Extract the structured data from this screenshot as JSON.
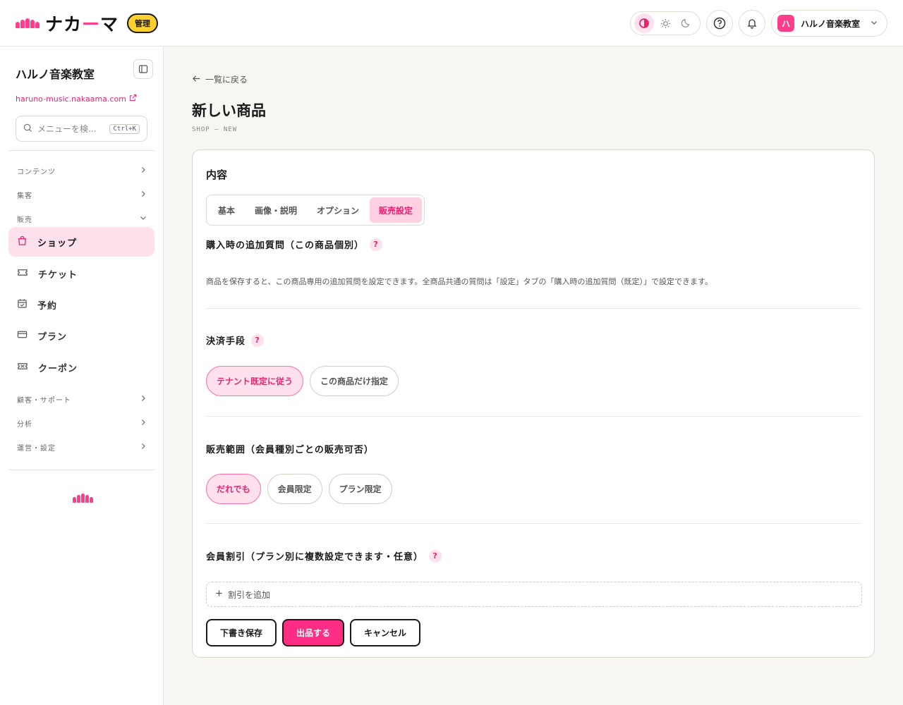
{
  "header": {
    "brand_main": "ナカ",
    "brand_accent": "ー",
    "brand_end": "マ",
    "admin_badge": "管理",
    "account_initial": "ハ",
    "account_name": "ハルノ音楽教室",
    "icons": [
      "contrast-icon",
      "sun-icon",
      "moon-icon",
      "help-circle-icon",
      "bell-icon",
      "chevron-down-icon"
    ]
  },
  "sidebar": {
    "title": "ハルノ音楽教室",
    "url": "haruno-music.nakaama.com",
    "search_placeholder": "メニューを検...",
    "search_shortcut": "Ctrl+K",
    "groups": {
      "content": "コンテンツ",
      "marketing": "集客",
      "sales": "販売",
      "customer": "顧客・サポート",
      "analytics": "分析",
      "settings": "運営・設定"
    },
    "items": {
      "shop": "ショップ",
      "ticket": "チケット",
      "reservation": "予約",
      "plan": "プラン",
      "coupon": "クーポン"
    }
  },
  "main": {
    "back_link": "一覧に戻る",
    "title": "新しい商品",
    "subtitle": "SHOP — NEW",
    "card": {
      "title": "内容",
      "tabs": {
        "basic": "基本",
        "images": "画像・説明",
        "options": "オプション",
        "sales": "販売設定"
      },
      "questions": {
        "title": "購入時の追加質問（この商品個別）",
        "description": "商品を保存すると、この商品専用の追加質問を設定できます。全商品共通の質問は「設定」タブの「購入時の追加質問（既定）」で設定できます。"
      },
      "payment": {
        "title": "決済手段",
        "options": {
          "default": "テナント既定に従う",
          "custom": "この商品だけ指定"
        }
      },
      "scope": {
        "title": "販売範囲（会員種別ごとの販売可否）",
        "options": {
          "anyone": "だれでも",
          "members": "会員限定",
          "plan": "プラン限定"
        }
      },
      "discount": {
        "title": "会員割引（プラン別に複数設定できます・任意）",
        "add_label": "割引を追加"
      },
      "actions": {
        "draft": "下書き保存",
        "publish": "出品する",
        "cancel": "キャンセル"
      }
    }
  },
  "colors": {
    "accent": "#ff2d84",
    "accent_soft": "#ffe1ee",
    "badge": "#ffd12e"
  }
}
